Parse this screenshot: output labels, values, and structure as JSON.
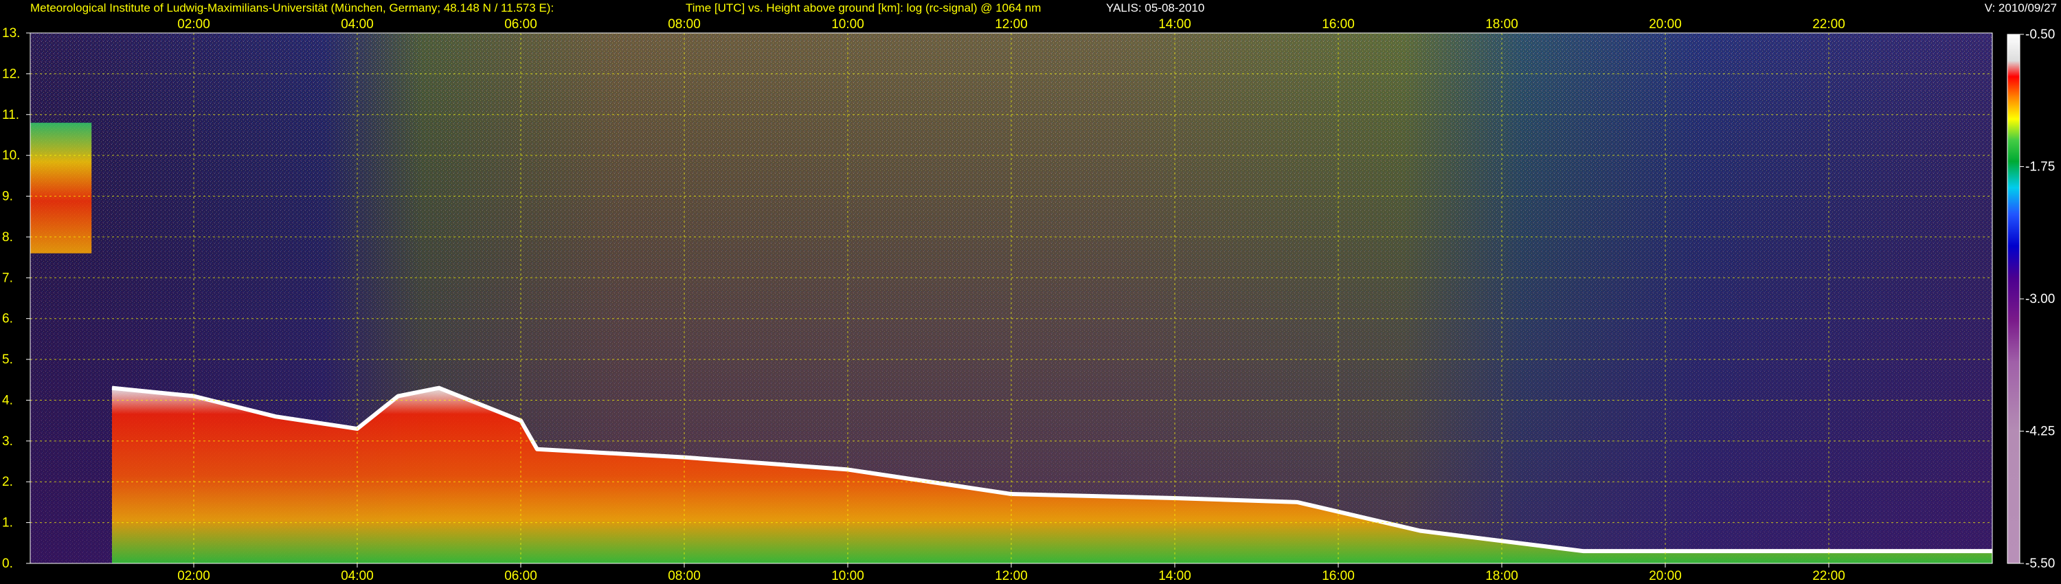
{
  "header": {
    "institute": "Meteorological Institute of Ludwig-Maximilians-Universität (München, Germany; 48.148 N / 11.573 E):",
    "description": "Time [UTC] vs. Height above ground [km]: log (rc-signal) @ 1064 nm",
    "instrument_date": "YALIS: 05-08-2010",
    "version": "V: 2010/09/27"
  },
  "chart_data": {
    "type": "heatmap",
    "title": "Time [UTC] vs. Height above ground [km]: log (rc-signal) @ 1064 nm",
    "xlabel": "Time [UTC]",
    "ylabel": "Height above ground [km]",
    "xlim": [
      0,
      24
    ],
    "ylim": [
      0,
      13
    ],
    "x_ticks": [
      "02:00",
      "04:00",
      "06:00",
      "08:00",
      "10:00",
      "12:00",
      "14:00",
      "16:00",
      "18:00",
      "20:00",
      "22:00"
    ],
    "y_ticks": [
      "0.",
      "1.",
      "2.",
      "3.",
      "4.",
      "5.",
      "6.",
      "7.",
      "8.",
      "9.",
      "10.",
      "11.",
      "12.",
      "13."
    ],
    "grid": true,
    "colorbar": {
      "label": "log (rc-signal)",
      "range": [
        -5.5,
        -0.5
      ],
      "ticks": [
        "-0.50",
        "-1.75",
        "-3.00",
        "-4.25",
        "-5.50"
      ],
      "colors": [
        "#ffffff",
        "#ff0000",
        "#ffaa00",
        "#ffff00",
        "#00cc33",
        "#00ccff",
        "#0000ff",
        "#4b0082",
        "#8a2be2",
        "#b48cb4"
      ]
    },
    "features": {
      "boundary_layer_top_km": [
        {
          "time_h": 1.0,
          "height": 4.3
        },
        {
          "time_h": 2.0,
          "height": 4.1
        },
        {
          "time_h": 3.0,
          "height": 3.6
        },
        {
          "time_h": 4.0,
          "height": 3.3
        },
        {
          "time_h": 4.5,
          "height": 4.1
        },
        {
          "time_h": 5.0,
          "height": 4.3
        },
        {
          "time_h": 6.0,
          "height": 3.5
        },
        {
          "time_h": 6.2,
          "height": 2.8
        },
        {
          "time_h": 8.0,
          "height": 2.6
        },
        {
          "time_h": 10.0,
          "height": 2.3
        },
        {
          "time_h": 12.0,
          "height": 1.7
        },
        {
          "time_h": 14.0,
          "height": 1.6
        },
        {
          "time_h": 15.5,
          "height": 1.5
        },
        {
          "time_h": 17.0,
          "height": 0.8
        },
        {
          "time_h": 19.0,
          "height": 0.3
        },
        {
          "time_h": 24.0,
          "height": 0.3
        }
      ],
      "cirrus": {
        "start_h": 0.0,
        "end_h": 0.75,
        "base_km": 7.6,
        "top_km": 10.8
      }
    }
  }
}
